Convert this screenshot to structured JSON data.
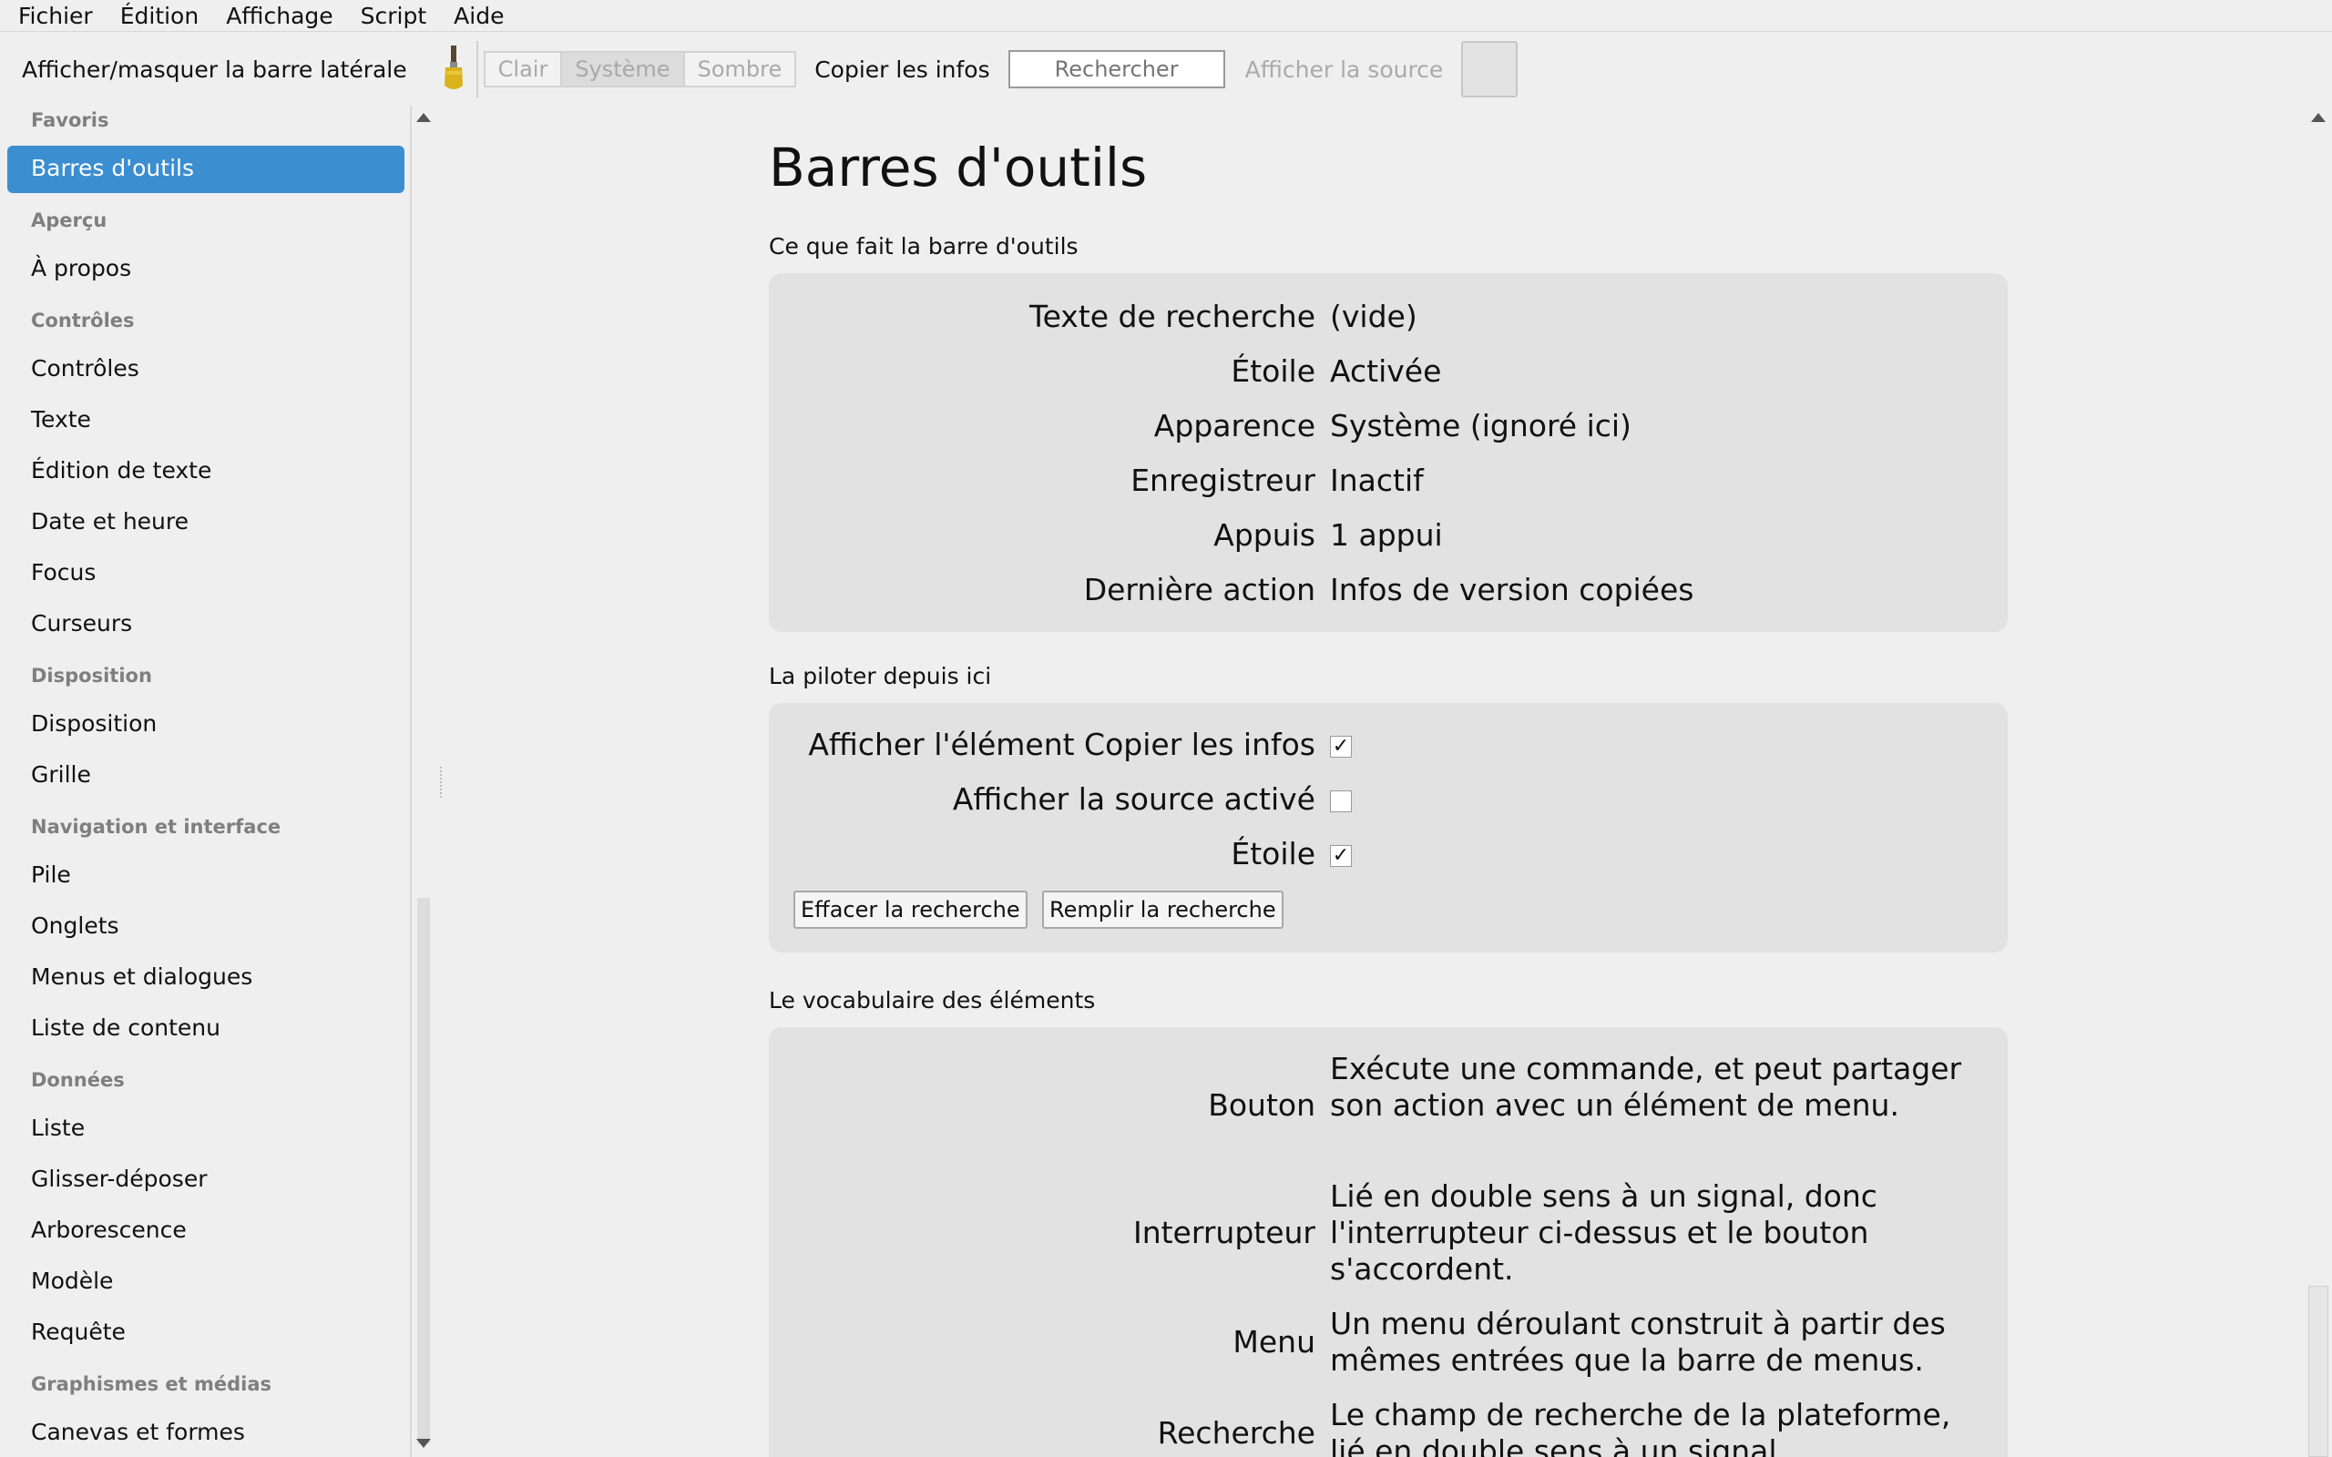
{
  "menubar": {
    "items": [
      "Fichier",
      "Édition",
      "Affichage",
      "Script",
      "Aide"
    ]
  },
  "toolbar": {
    "sidebar_toggle": "Afficher/masquer la barre latérale",
    "brush_icon": "paintbrush-icon",
    "appearance": {
      "light": "Clair",
      "system": "Système",
      "dark": "Sombre",
      "selected": "Système"
    },
    "copy_info": "Copier les infos",
    "search_placeholder": "Rechercher",
    "show_source": "Afficher la source",
    "star_icon": "star-icon"
  },
  "sidebar": {
    "sections": [
      {
        "title": "Favoris",
        "items": [
          "Barres d'outils"
        ]
      },
      {
        "title": "Aperçu",
        "items": [
          "À propos"
        ]
      },
      {
        "title": "Contrôles",
        "items": [
          "Contrôles",
          "Texte",
          "Édition de texte",
          "Date et heure",
          "Focus",
          "Curseurs"
        ]
      },
      {
        "title": "Disposition",
        "items": [
          "Disposition",
          "Grille"
        ]
      },
      {
        "title": "Navigation et interface",
        "items": [
          "Pile",
          "Onglets",
          "Menus et dialogues",
          "Liste de contenu"
        ]
      },
      {
        "title": "Données",
        "items": [
          "Liste",
          "Glisser-déposer",
          "Arborescence",
          "Modèle",
          "Requête"
        ]
      },
      {
        "title": "Graphismes et médias",
        "items": [
          "Canevas et formes"
        ]
      }
    ],
    "selected": "Barres d'outils",
    "accent_color": "#3b8ed0"
  },
  "main": {
    "title": "Barres d'outils",
    "status_section": {
      "title": "Ce que fait la barre d'outils",
      "rows": [
        {
          "label": "Texte de recherche",
          "value": "(vide)"
        },
        {
          "label": "Étoile",
          "value": "Activée"
        },
        {
          "label": "Apparence",
          "value": "Système (ignoré ici)"
        },
        {
          "label": "Enregistreur",
          "value": "Inactif"
        },
        {
          "label": "Appuis",
          "value": "1 appui"
        },
        {
          "label": "Dernière action",
          "value": "Infos de version copiées"
        }
      ]
    },
    "control_section": {
      "title": "La piloter depuis ici",
      "checks": [
        {
          "label": "Afficher l'élément Copier les infos",
          "checked": true,
          "mark": "✓"
        },
        {
          "label": "Afficher la source activé",
          "checked": false,
          "mark": ""
        },
        {
          "label": "Étoile",
          "checked": true,
          "mark": "✓"
        }
      ],
      "buttons": {
        "clear": "Effacer la recherche",
        "fill": "Remplir la recherche"
      }
    },
    "vocab_section": {
      "title": "Le vocabulaire des éléments",
      "rows": [
        {
          "label": "Bouton",
          "desc": "Exécute une commande, et peut partager son action avec un élément de menu."
        },
        {
          "label": "Interrupteur",
          "desc": "Lié en double sens à un signal, donc l'interrupteur ci-dessus et le bouton s'accordent."
        },
        {
          "label": "Menu",
          "desc": "Un menu déroulant construit à partir des mêmes entrées que la barre de menus."
        },
        {
          "label": "Recherche",
          "desc": "Le champ de recherche de la plateforme, lié en double sens à un signal."
        }
      ]
    }
  }
}
